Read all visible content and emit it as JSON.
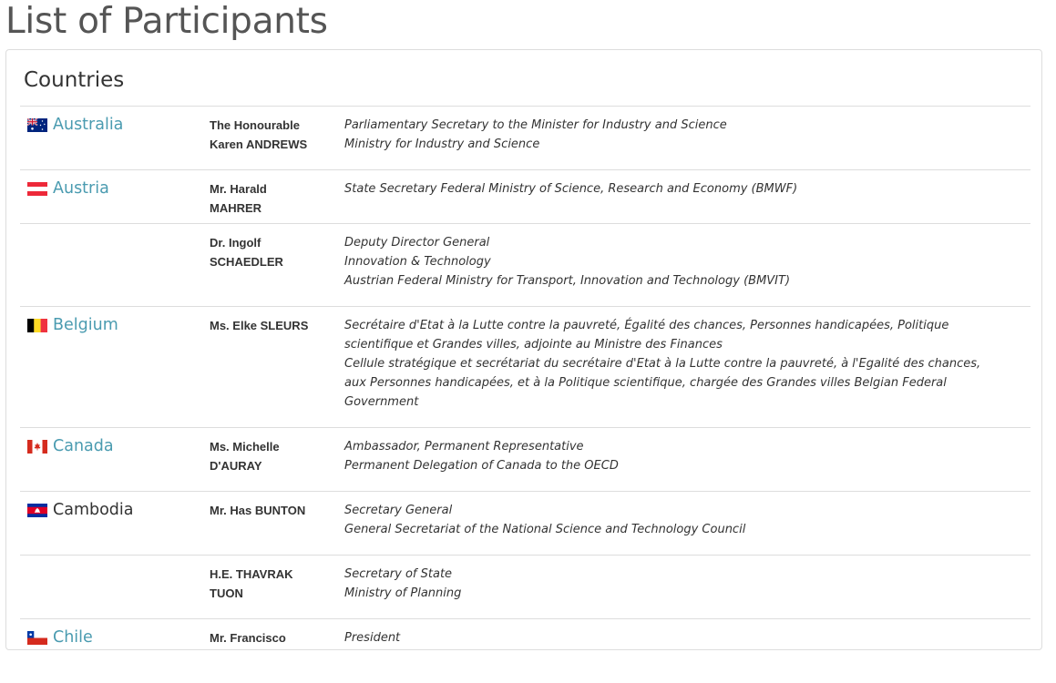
{
  "page": {
    "title": "List of Participants"
  },
  "section": {
    "title": "Countries"
  },
  "rows": [
    {
      "country": "Australia",
      "name_line1": "The Honourable",
      "name_line2": "Karen ANDREWS",
      "role_lines": [
        "Parliamentary Secretary to the Minister for Industry and Science",
        "Ministry for Industry and Science"
      ]
    },
    {
      "country": "Austria",
      "name_line1": "Mr. Harald",
      "name_line2": "MAHRER",
      "role_lines": [
        "State Secretary Federal Ministry of Science, Research and Economy (BMWF)"
      ]
    },
    {
      "country": "",
      "name_line1": "Dr. Ingolf",
      "name_line2": "SCHAEDLER",
      "role_lines": [
        "Deputy Director General",
        "Innovation & Technology",
        "Austrian Federal Ministry for Transport, Innovation and Technology (BMVIT)"
      ]
    },
    {
      "country": "Belgium",
      "name_line1": "Ms. Elke SLEURS",
      "name_line2": "",
      "role_lines": [
        "Secrétaire d'Etat à la Lutte contre la pauvreté, Égalité des chances, Personnes handicapées, Politique",
        "scientifique et Grandes villes, adjointe au Ministre des Finances",
        "Cellule stratégique et secrétariat du secrétaire d'Etat à la Lutte contre la pauvreté, à l'Egalité des chances,",
        "aux Personnes handicapées, et à la Politique scientifique, chargée des Grandes villes Belgian Federal",
        "Government"
      ]
    },
    {
      "country": "Canada",
      "name_line1": "Ms. Michelle",
      "name_line2": "D'AURAY",
      "role_lines": [
        "Ambassador, Permanent Representative",
        "Permanent Delegation of Canada to the OECD"
      ]
    },
    {
      "country": "Cambodia",
      "name_line1": "Mr. Has BUNTON",
      "name_line2": "",
      "role_lines": [
        "Secretary General",
        "General Secretariat of the National Science and Technology Council"
      ]
    },
    {
      "country": "",
      "name_line1": "H.E. THAVRAK",
      "name_line2": "TUON",
      "role_lines": [
        "Secretary of State",
        "Ministry of Planning"
      ]
    },
    {
      "country": "Chile",
      "name_line1": "Mr. Francisco",
      "name_line2": "",
      "role_lines": [
        "President"
      ]
    }
  ],
  "flags": {
    "australia": "australia-flag-icon",
    "austria": "austria-flag-icon",
    "belgium": "belgium-flag-icon",
    "canada": "canada-flag-icon",
    "cambodia": "cambodia-flag-icon",
    "chile": "chile-flag-icon"
  },
  "colors": {
    "link": "#4a9bb0",
    "text": "#333333",
    "border": "#dddddd",
    "title": "#555555"
  }
}
